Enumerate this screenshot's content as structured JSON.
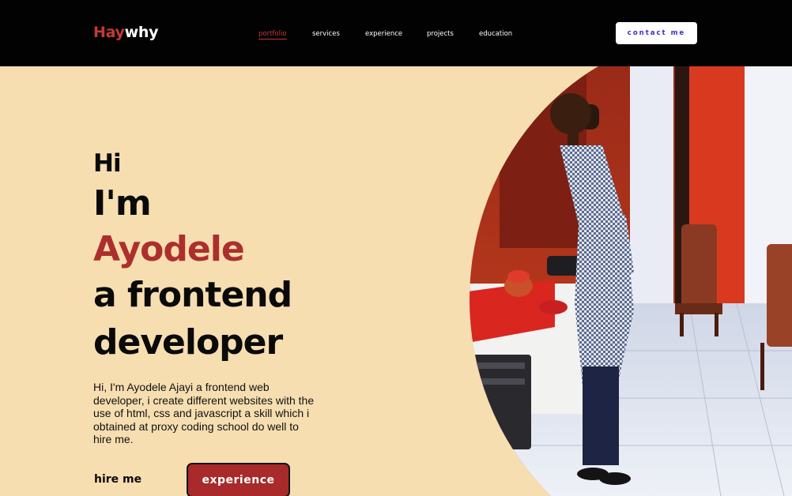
{
  "nav": {
    "logo_part1": "Hay",
    "logo_part2": "why",
    "links": [
      "portfolio",
      "services",
      "experience",
      "projects",
      "education"
    ],
    "active_link": "portfolio",
    "contact_label": "contact me"
  },
  "hero": {
    "greeting": "Hi",
    "im": "I'm",
    "name": "Ayodele",
    "role_line1": "a frontend",
    "role_line2": "developer",
    "intro": "Hi, I'm Ayodele Ajayi a frontend web developer, i create different websites with the use of html, css and javascript a skill which i obtained at proxy coding school do well to hire me.",
    "hire_label": "hire me",
    "experience_label": "experience"
  },
  "colors": {
    "page_bg": "#f6deb0",
    "nav_bg": "#020202",
    "accent_red": "#c43a32",
    "name_red": "#ad2f2d",
    "button_red": "#a82a2a",
    "contact_text": "#3b2fd0"
  },
  "portrait": {
    "alt": "Photo of Ayodele"
  }
}
